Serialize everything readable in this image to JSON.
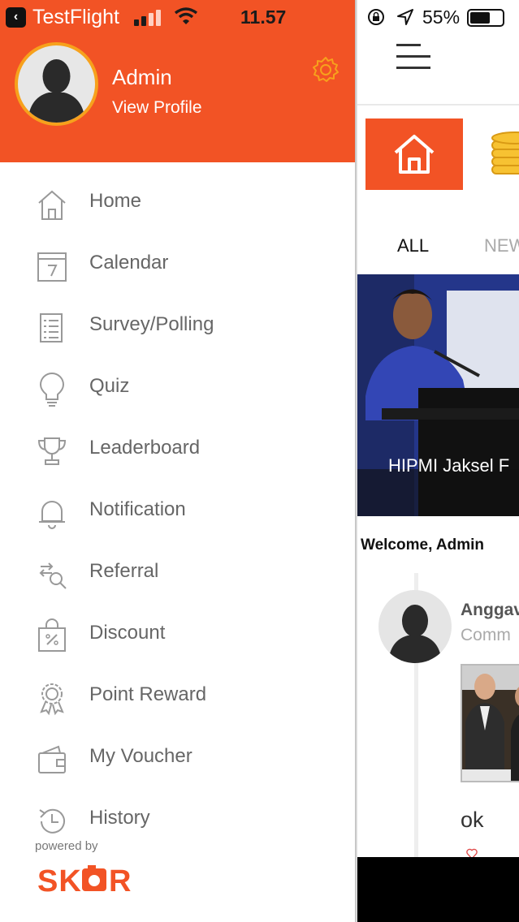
{
  "status": {
    "back_app": "TestFlight",
    "time": "11.57",
    "battery": "55%"
  },
  "profile": {
    "name": "Admin",
    "link": "View Profile"
  },
  "menu": [
    {
      "label": "Home",
      "icon": "home-icon"
    },
    {
      "label": "Calendar",
      "icon": "calendar-icon"
    },
    {
      "label": "Survey/Polling",
      "icon": "survey-icon"
    },
    {
      "label": "Quiz",
      "icon": "lightbulb-icon"
    },
    {
      "label": "Leaderboard",
      "icon": "trophy-icon"
    },
    {
      "label": "Notification",
      "icon": "bell-icon"
    },
    {
      "label": "Referral",
      "icon": "referral-icon"
    },
    {
      "label": "Discount",
      "icon": "discount-icon"
    },
    {
      "label": "Point Reward",
      "icon": "badge-icon"
    },
    {
      "label": "My Voucher",
      "icon": "wallet-icon"
    },
    {
      "label": "History",
      "icon": "history-icon"
    }
  ],
  "footer": {
    "powered_by": "powered by",
    "logo_text": "SKOR"
  },
  "main": {
    "tabs": [
      "ALL",
      "NEW"
    ],
    "banner_caption": "HIPMI Jaksel F",
    "welcome": "Welcome, Admin",
    "post": {
      "author": "Anggav",
      "subtitle": "Comm",
      "text": "ok"
    }
  },
  "colors": {
    "brand": "#f25325",
    "avatar_ring": "#f7a11c",
    "menu_text": "#666666"
  }
}
